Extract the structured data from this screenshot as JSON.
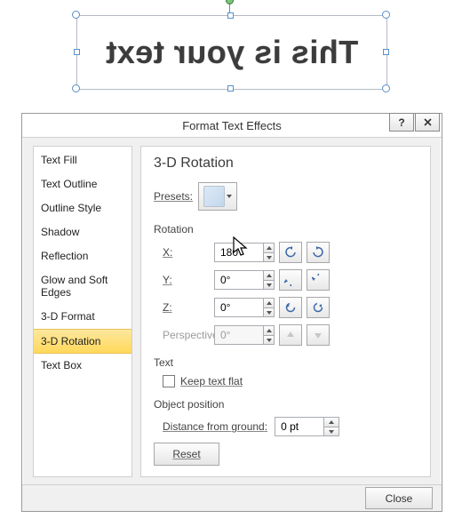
{
  "textbox": {
    "content": "This is your text"
  },
  "dialog": {
    "title": "Format Text Effects",
    "sidebar": {
      "items": [
        {
          "label": "Text Fill"
        },
        {
          "label": "Text Outline"
        },
        {
          "label": "Outline Style"
        },
        {
          "label": "Shadow"
        },
        {
          "label": "Reflection"
        },
        {
          "label": "Glow and Soft Edges"
        },
        {
          "label": "3-D Format"
        },
        {
          "label": "3-D Rotation"
        },
        {
          "label": "Text Box"
        }
      ],
      "selected_index": 7
    },
    "panel": {
      "heading": "3-D Rotation",
      "presets_label": "Presets:",
      "rotation": {
        "group": "Rotation",
        "x": {
          "label": "X:",
          "value": "180°"
        },
        "y": {
          "label": "Y:",
          "value": "0°"
        },
        "z": {
          "label": "Z:",
          "value": "0°"
        },
        "perspective": {
          "label": "Perspective:",
          "value": "0°"
        }
      },
      "text": {
        "group": "Text",
        "keep_flat_label": "Keep text flat",
        "keep_flat_checked": false
      },
      "object_position": {
        "group": "Object position",
        "distance_label": "Distance from ground:",
        "distance_value": "0 pt"
      },
      "reset_label": "Reset"
    },
    "close_label": "Close"
  }
}
